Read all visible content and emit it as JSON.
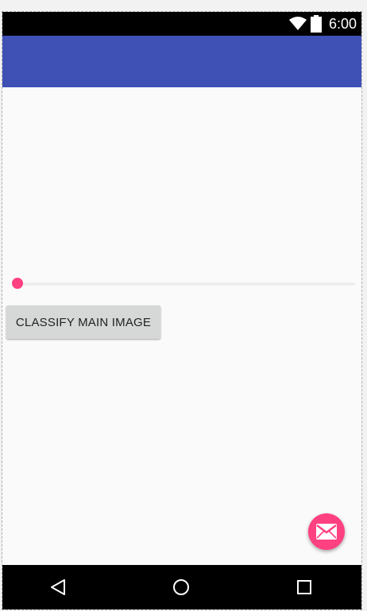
{
  "status_bar": {
    "time": "6:00",
    "icons": [
      "wifi-icon",
      "battery-icon"
    ]
  },
  "app_bar": {
    "color": "#3f51b5"
  },
  "seekbar": {
    "progress_percent": 0,
    "thumb_color": "#ff4081"
  },
  "main": {
    "classify_button_label": "CLASSIFY MAIN IMAGE"
  },
  "fab": {
    "icon": "mail-icon",
    "color": "#ff4081"
  },
  "nav_bar": {
    "icons": [
      "back-icon",
      "home-icon",
      "recents-icon"
    ]
  }
}
